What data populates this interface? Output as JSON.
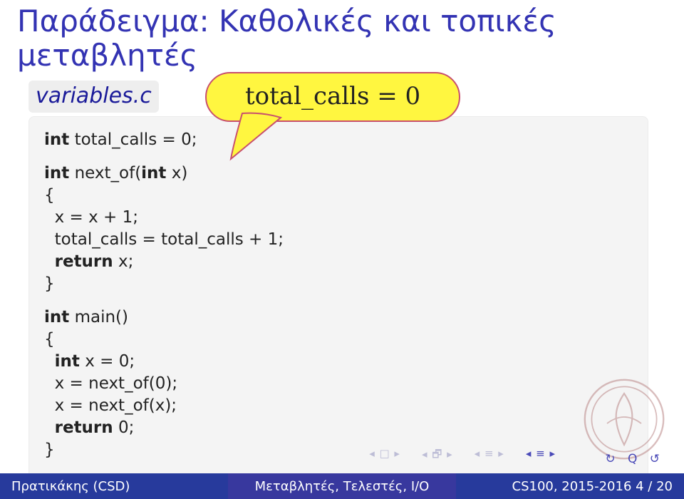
{
  "title_line1": "Παράδειγμα: Καθολικές και τοπικές",
  "title_line2": "μεταβλητές",
  "file_label": "variables.c",
  "callout_text": "total_calls = 0",
  "code": {
    "l1_kw": "int",
    "l1_rest": " total_calls = 0;",
    "l2_kw1": "int",
    "l2_mid": " next_of(",
    "l2_kw2": "int",
    "l2_end": " x)",
    "l3": "{",
    "l4": "  x = x + 1;",
    "l5": "  total_calls = total_calls + 1;",
    "l6_indent": "  ",
    "l6_kw": "return",
    "l6_rest": " x;",
    "l7": "}",
    "l8_kw": "int",
    "l8_rest": " main()",
    "l9": "{",
    "l10_indent": "  ",
    "l10_kw": "int",
    "l10_rest": " x = 0;",
    "l11": "  x = next_of(0);",
    "l12": "  x = next_of(x);",
    "l13_indent": "  ",
    "l13_kw": "return",
    "l13_rest": " 0;",
    "l14": "}"
  },
  "footer": {
    "left": "Πρατικάκης (CSD)",
    "mid": "Μεταβλητές, Τελεστές, I/O",
    "right": "CS100, 2015-2016      4 / 20"
  }
}
